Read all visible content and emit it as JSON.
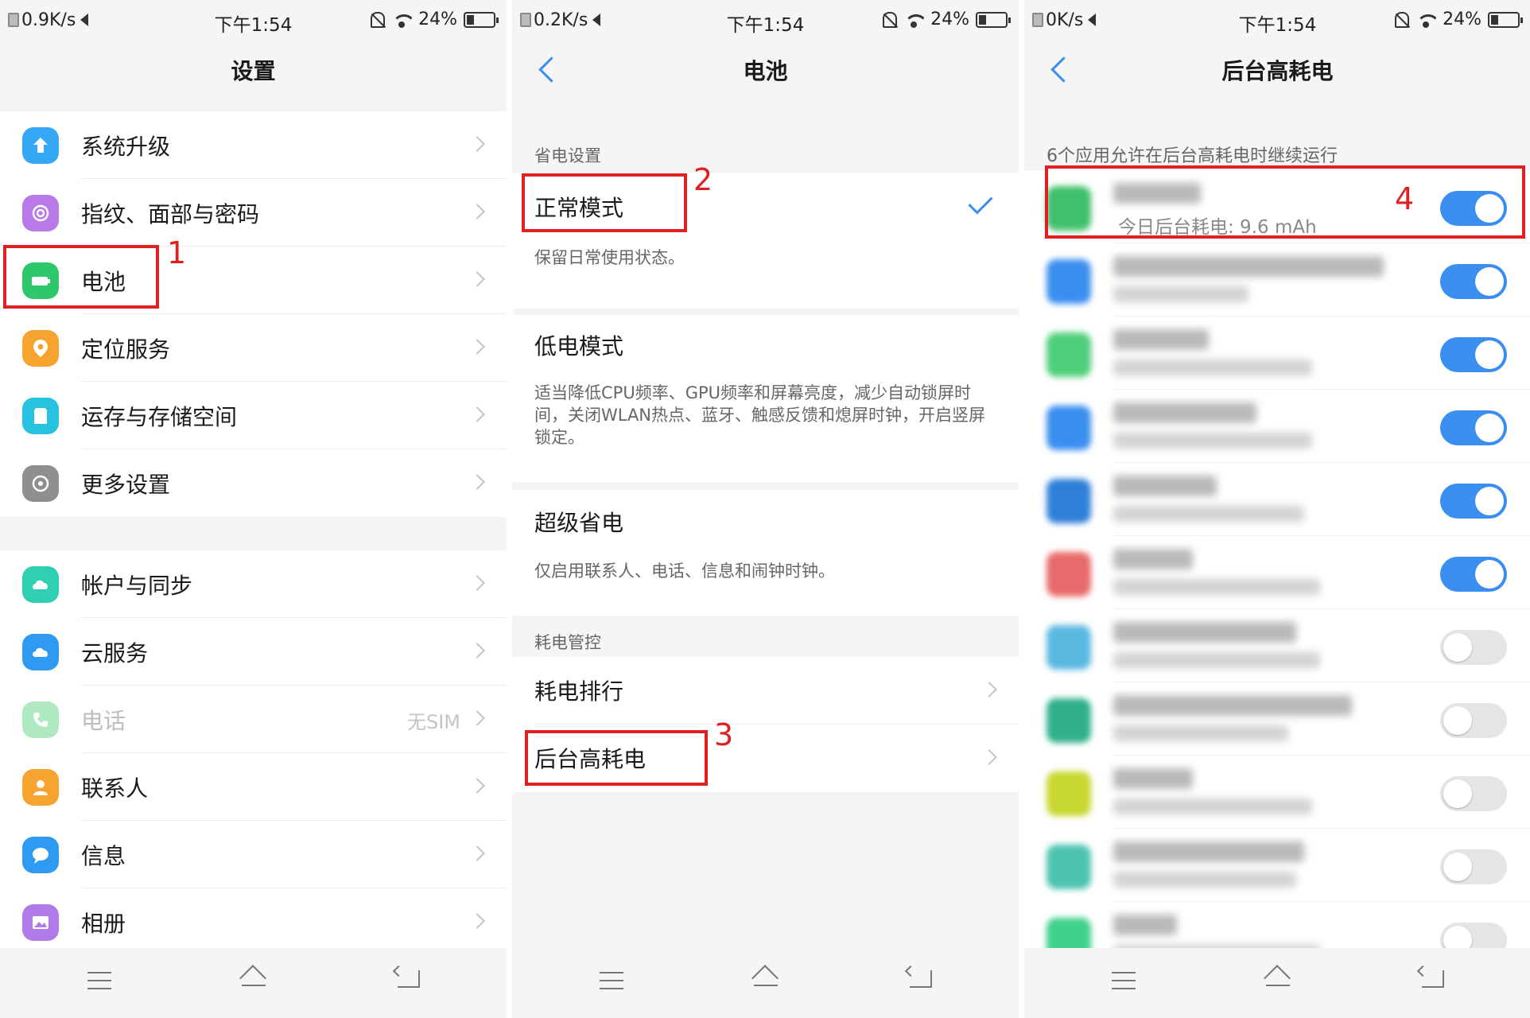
{
  "colors": {
    "accent": "#3a8ef0",
    "annotation": "#e02020"
  },
  "statusbars": [
    {
      "net": "0.9K/s",
      "time": "下午1:54",
      "battery": "24%"
    },
    {
      "net": "0.2K/s",
      "time": "下午1:54",
      "battery": "24%"
    },
    {
      "net": "0K/s",
      "time": "下午1:54",
      "battery": "24%"
    }
  ],
  "settings": {
    "title": "设置",
    "group1": [
      {
        "label": "系统升级",
        "icon": "system-update-icon"
      },
      {
        "label": "指纹、面部与密码",
        "icon": "fingerprint-icon"
      },
      {
        "label": "电池",
        "icon": "battery-icon"
      },
      {
        "label": "定位服务",
        "icon": "location-pin-icon"
      },
      {
        "label": "运存与存储空间",
        "icon": "storage-icon"
      },
      {
        "label": "更多设置",
        "icon": "gear-icon"
      }
    ],
    "group2": [
      {
        "label": "帐户与同步",
        "icon": "account-sync-icon"
      },
      {
        "label": "云服务",
        "icon": "cloud-icon"
      },
      {
        "label": "电话",
        "icon": "phone-icon",
        "extra": "无SIM"
      },
      {
        "label": "联系人",
        "icon": "contact-icon"
      },
      {
        "label": "信息",
        "icon": "message-icon"
      },
      {
        "label": "相册",
        "icon": "gallery-icon"
      }
    ]
  },
  "battery": {
    "title": "电池",
    "section_power": "省电设置",
    "normal_mode": "正常模式",
    "normal_desc": "保留日常使用状态。",
    "low_mode": "低电模式",
    "low_desc": "适当降低CPU频率、GPU频率和屏幕亮度，减少自动锁屏时间，关闭WLAN热点、蓝牙、触感反馈和熄屏时钟，开启竖屏锁定。",
    "super_mode": "超级省电",
    "super_desc": "仅启用联系人、电话、信息和闹钟时钟。",
    "section_control": "耗电管控",
    "ranking": "耗电排行",
    "high_bg": "后台高耗电"
  },
  "highbg": {
    "title": "后台高耗电",
    "caption": "6个应用允许在后台高耗电时继续运行",
    "first_sub": "今日后台耗电: 9.6 mAh",
    "toggles": [
      true,
      true,
      true,
      true,
      true,
      true,
      false,
      false,
      false,
      false,
      false
    ]
  },
  "annotations": [
    "1",
    "2",
    "3",
    "4"
  ]
}
